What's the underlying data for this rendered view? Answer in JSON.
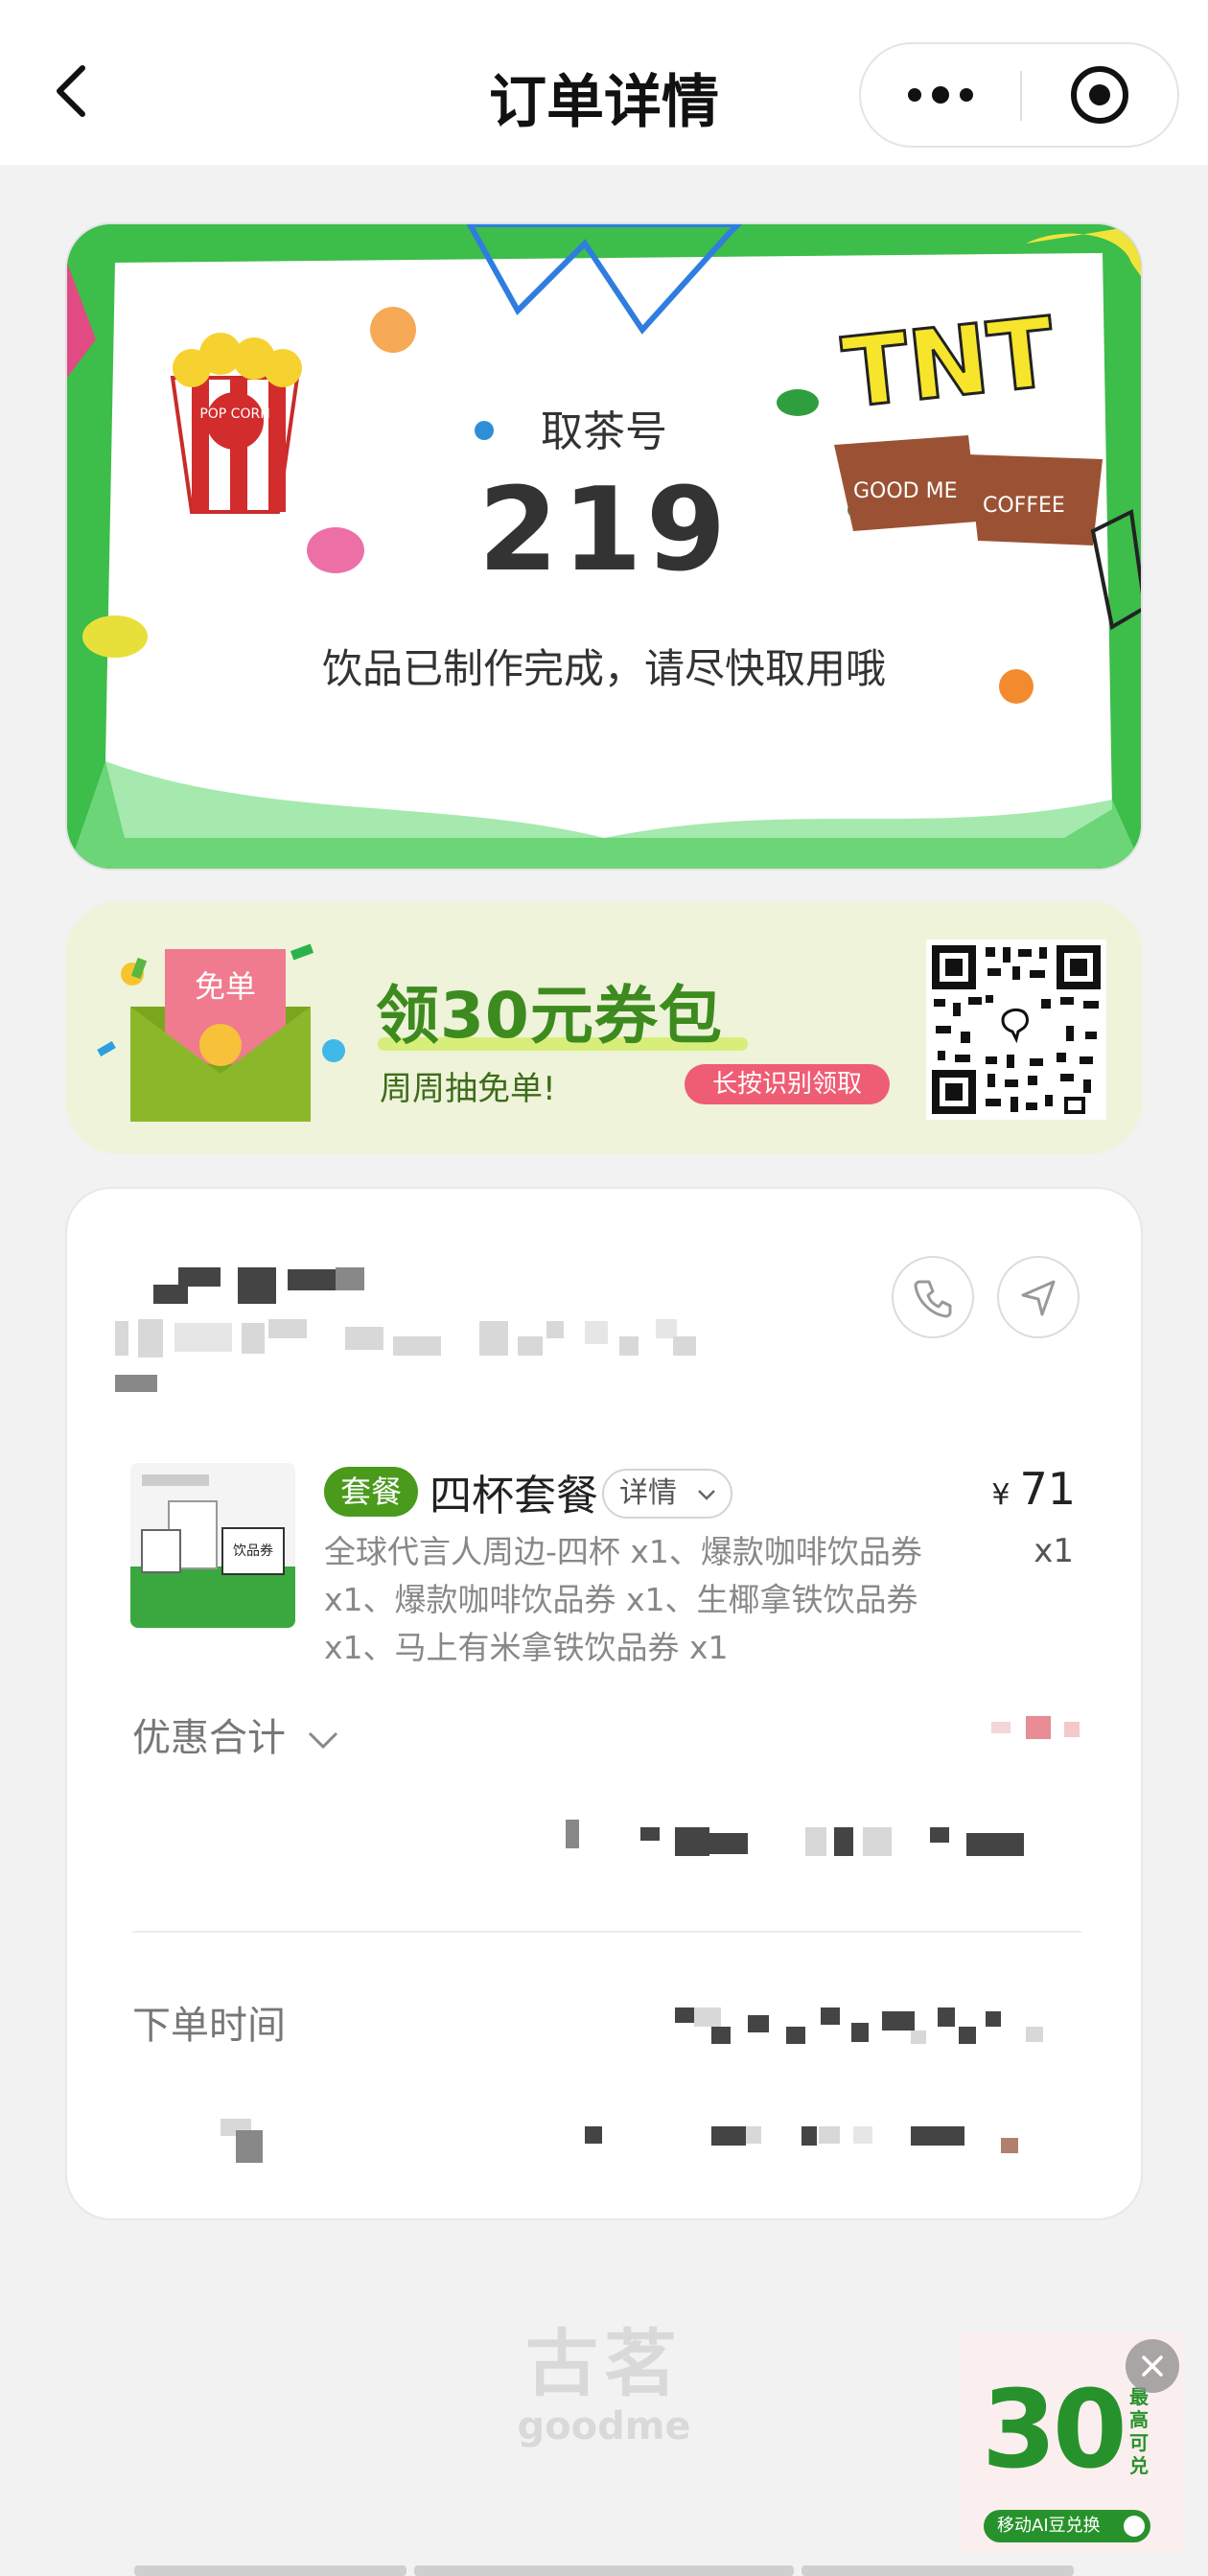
{
  "nav": {
    "title": "订单详情",
    "back_icon": "chevron-left-icon",
    "more_icon": "more-dots-icon",
    "close_icon": "target-circle-icon"
  },
  "pickup": {
    "label": "取茶号",
    "number": "219",
    "message": "饮品已制作完成，请尽快取用哦",
    "art_texts": [
      "TNT",
      "GOOD ME",
      "COFFEE",
      "POP CORN"
    ]
  },
  "coupon": {
    "envelope_text": "免单",
    "title": "领30元券包",
    "subtitle": "周周抽免单!",
    "cta": "长按识别领取"
  },
  "order": {
    "product": {
      "tag": "套餐",
      "name": "四杯套餐",
      "detail_label": "详情",
      "price_symbol": "¥",
      "price": "71",
      "quantity": "x1",
      "description": "全球代言人周边-四杯 x1、爆款咖啡饮品券 x1、爆款咖啡饮品券 x1、生椰拿铁饮品券 x1、马上有米拿铁饮品券 x1",
      "image_label": "饮品券"
    },
    "discount_label": "优惠合计",
    "order_time_label": "下单时间"
  },
  "footer": {
    "brand_cn": "古茗",
    "brand_en": "goodme"
  },
  "ad": {
    "number": "30",
    "side_text": "最高可兑",
    "pill_text": "移动AI豆兑换"
  },
  "colors": {
    "brand_green": "#4a9a1c",
    "coupon_green": "#3d8b1f",
    "pickup_bg": "#3fbf4a",
    "coupon_bg": "#eef3da",
    "cta_pink": "#ef5d74"
  }
}
